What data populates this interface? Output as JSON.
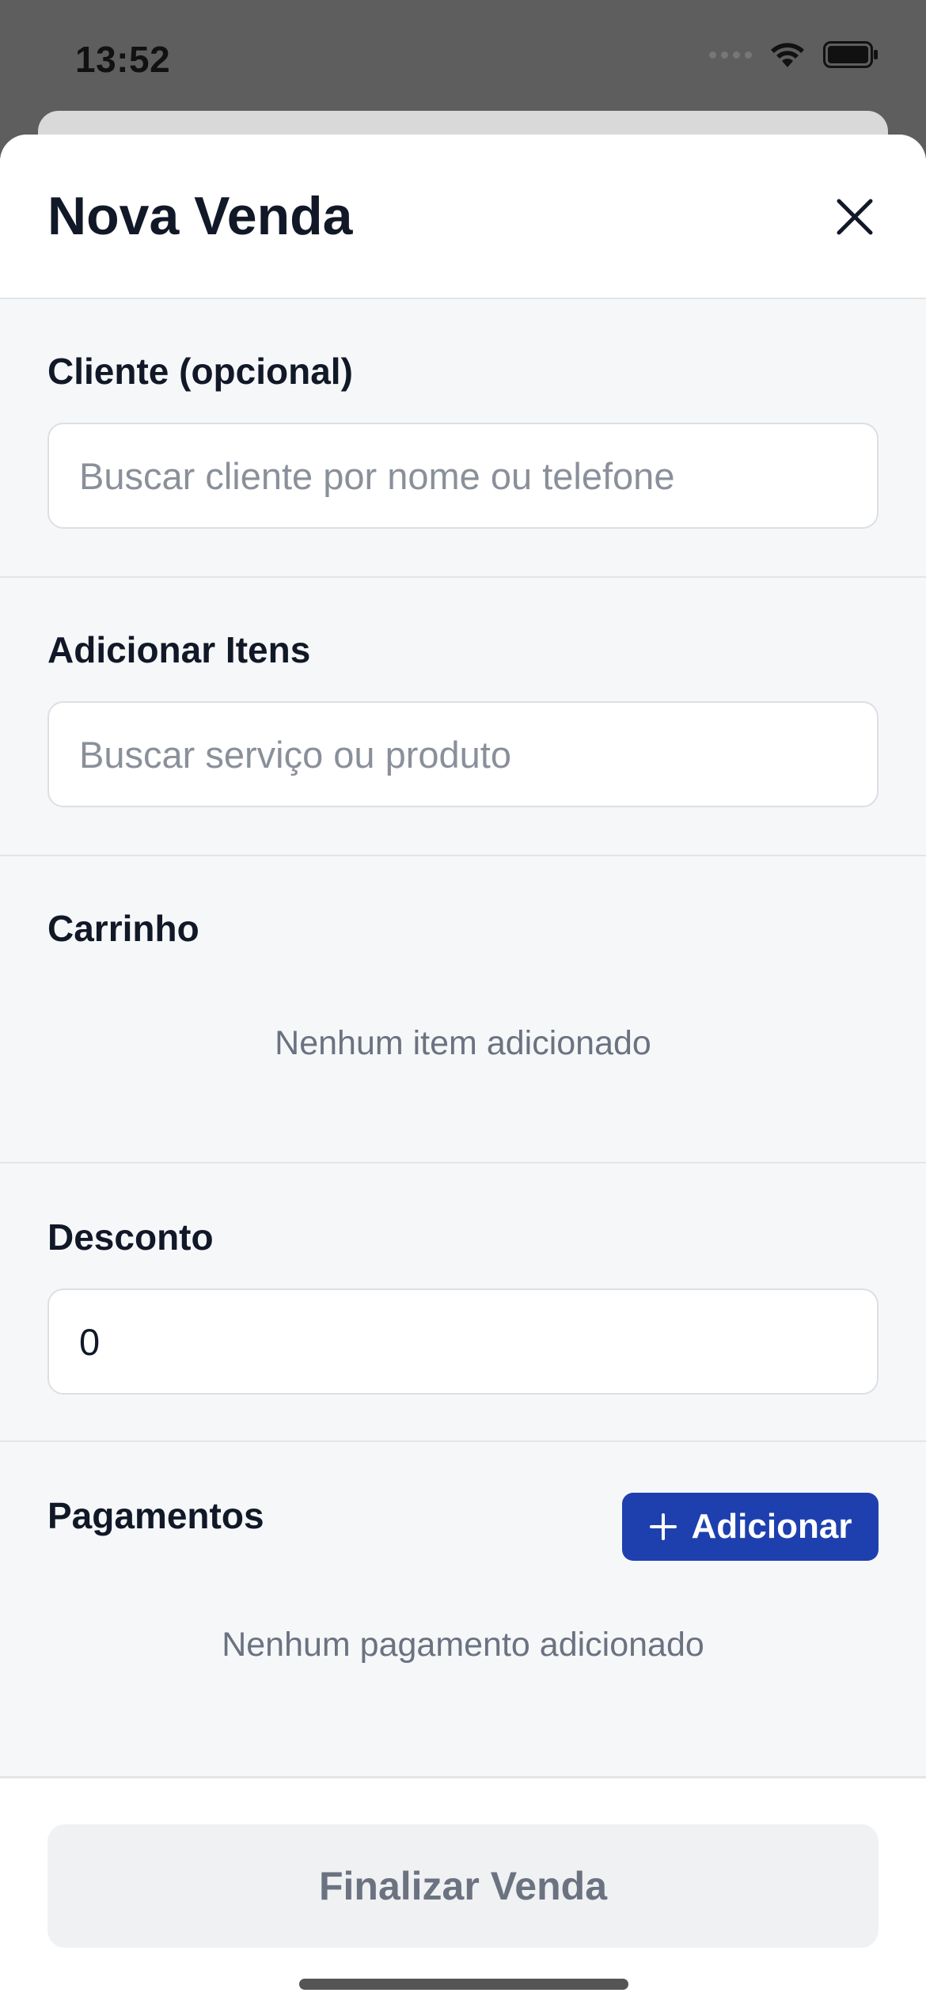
{
  "status_bar": {
    "time": "13:52",
    "icons": [
      "cellular-dots-icon",
      "wifi-icon",
      "battery-icon"
    ]
  },
  "sheet": {
    "title": "Nova Venda",
    "close_icon": "close-icon"
  },
  "cliente": {
    "label": "Cliente (opcional)",
    "placeholder": "Buscar cliente por nome ou telefone"
  },
  "itens": {
    "label": "Adicionar Itens",
    "placeholder": "Buscar serviço ou produto"
  },
  "carrinho": {
    "label": "Carrinho",
    "empty": "Nenhum item adicionado"
  },
  "desconto": {
    "label": "Desconto",
    "value": "0"
  },
  "pagamentos": {
    "label": "Pagamentos",
    "add_label": "Adicionar",
    "empty": "Nenhum pagamento adicionado"
  },
  "footer": {
    "finalize_label": "Finalizar Venda"
  },
  "colors": {
    "accent": "#1e40af",
    "sheet_bg": "#f6f7f9",
    "overlay": "#5e5e5e"
  }
}
